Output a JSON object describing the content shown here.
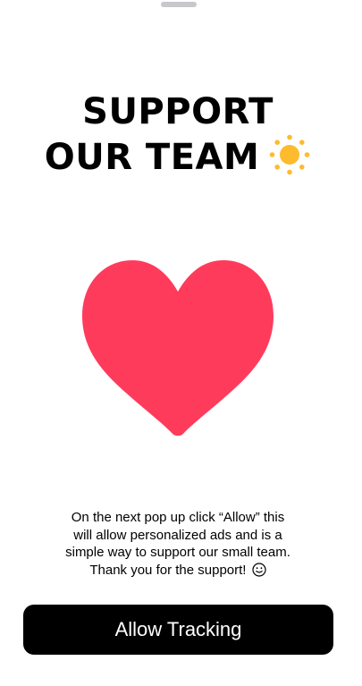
{
  "title": {
    "line1": "SUPPORT",
    "line2": "OUR TEAM",
    "emoji_icon": "sun-icon"
  },
  "hero": {
    "icon": "heart-icon",
    "color": "#ff3b5c"
  },
  "message": {
    "line1": "On the next pop up click “Allow” this",
    "line2": "will allow personalized ads and is a",
    "line3": "simple way to support our small team.",
    "line4": "Thank you for the support!",
    "emoji_icon": "smiley-icon"
  },
  "cta": {
    "label": "Allow Tracking",
    "background": "#000000",
    "text_color": "#ffffff"
  },
  "colors": {
    "sun": "#fdbb2d",
    "background": "#ffffff"
  }
}
